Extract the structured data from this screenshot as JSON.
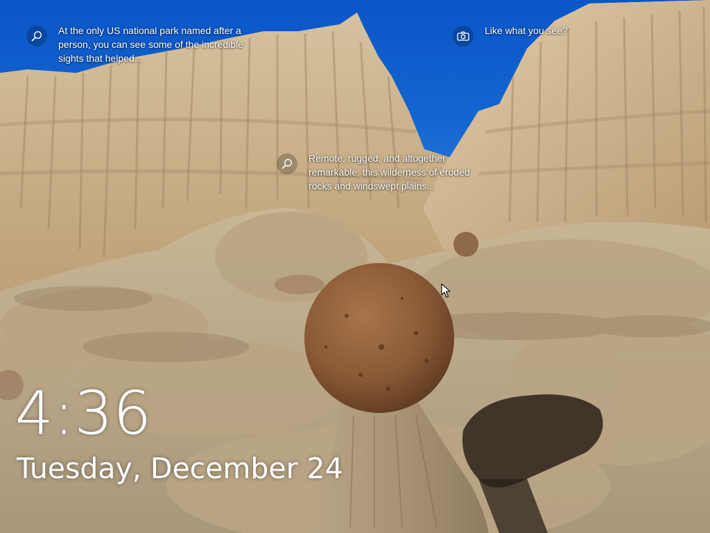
{
  "lock_screen": {
    "spotlight": {
      "hotspot_1": {
        "icon": "search-icon",
        "text": "At the only US national park named after a person, you can see some of the incredible sights that helped..."
      },
      "hotspot_2": {
        "icon": "camera-icon",
        "text": "Like what you see?"
      },
      "hotspot_3": {
        "icon": "search-icon",
        "text": "Remote, rugged, and altogether remarkable, this wilderness of eroded rocks and windswept plains..."
      }
    },
    "clock": {
      "time": "4:36",
      "date": "Tuesday, December 24"
    }
  },
  "colors": {
    "sky": "#1364d0",
    "rock": "#c8ae86",
    "concretion": "#8a5a36",
    "text": "#ffffff"
  }
}
